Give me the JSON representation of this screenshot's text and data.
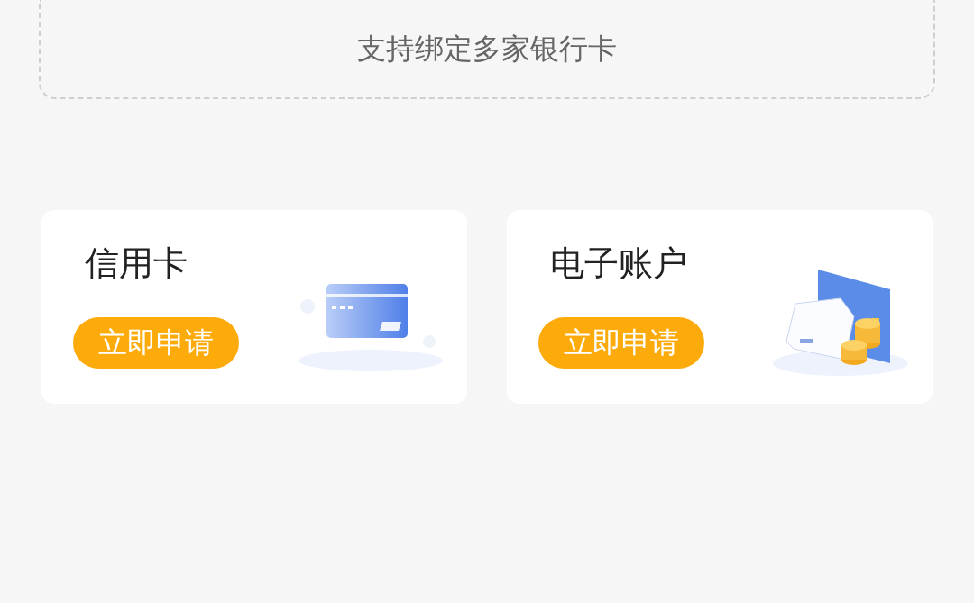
{
  "bind_card": {
    "subtitle": "支持绑定多家银行卡"
  },
  "products": [
    {
      "kind": "credit_card",
      "title": "信用卡",
      "button": "立即申请"
    },
    {
      "kind": "e_account",
      "title": "电子账户",
      "button": "立即申请"
    }
  ]
}
